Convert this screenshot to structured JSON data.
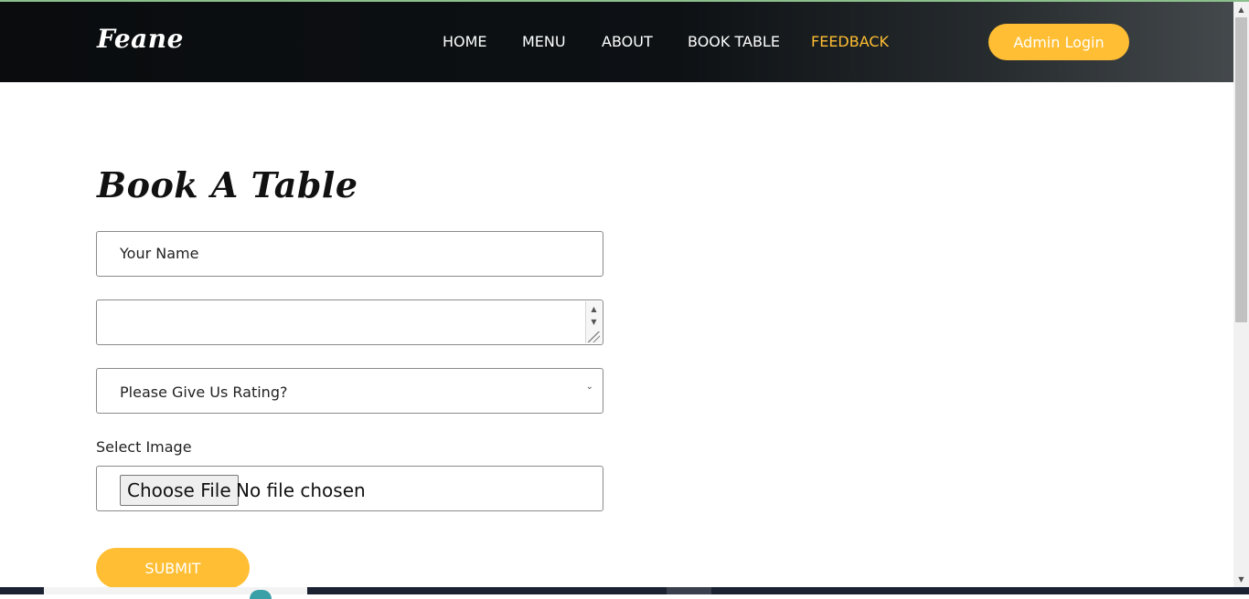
{
  "brand": {
    "logo": "Feane"
  },
  "nav": {
    "items": [
      {
        "label": "HOME",
        "active": false
      },
      {
        "label": "MENU",
        "active": false
      },
      {
        "label": "ABOUT",
        "active": false
      },
      {
        "label": "BOOK TABLE",
        "active": false
      },
      {
        "label": "FEEDBACK",
        "active": true
      }
    ],
    "admin_label": "Admin Login"
  },
  "form": {
    "title": "Book A Table",
    "name_placeholder": "Your Name",
    "message_value": "",
    "rating_selected": "Please Give Us Rating?",
    "image_label": "Select Image",
    "file_button": "Choose File",
    "file_status": "No file chosen",
    "submit_label": "SUBMIT"
  },
  "colors": {
    "accent": "#ffbe33",
    "header_bg": "#0c0f11"
  },
  "icons": {
    "spin_up": "triangle-up-icon",
    "spin_down": "triangle-down-icon",
    "select": "chevron-down-icon"
  }
}
